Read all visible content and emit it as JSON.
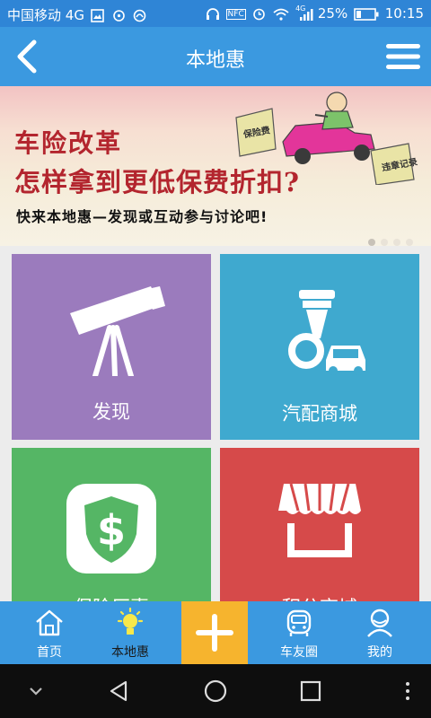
{
  "status_bar": {
    "carrier": "中国移动",
    "network": "4G",
    "signal_label": "4G",
    "battery": "25%",
    "time": "10:15",
    "nfc": "NFC"
  },
  "header": {
    "title": "本地惠"
  },
  "banner": {
    "headline_1": "车险改革",
    "headline_2": "怎样拿到更低保费折扣?",
    "tagline": "快来本地惠—发现或互动参与讨论吧!",
    "sign_left": "保险费",
    "sign_right": "违章记录",
    "slide_count": 4,
    "active_slide": 1
  },
  "tiles": [
    {
      "label": "发现",
      "icon": "telescope-icon",
      "color": "#9b7bbd"
    },
    {
      "label": "汽配商城",
      "icon": "engine-car-icon",
      "color": "#3fa9cf"
    },
    {
      "label": "保险厂惠",
      "icon": "dollar-shield-icon",
      "color": "#55b665"
    },
    {
      "label": "积分商城",
      "icon": "shop-awning-icon",
      "color": "#d64a4a"
    }
  ],
  "tab_bar": {
    "tabs": [
      {
        "label": "首页",
        "icon": "home-icon"
      },
      {
        "label": "本地惠",
        "icon": "lightbulb-icon"
      },
      {
        "label": "车友圈",
        "icon": "car-front-icon"
      },
      {
        "label": "我的",
        "icon": "user-icon"
      }
    ],
    "center_icon": "plus-icon",
    "active": "本地惠"
  },
  "colors": {
    "status_bar": "#2f85d6",
    "app_bar": "#3b99e0",
    "plus_button": "#f6b42e",
    "active_tab_icon": "#f7e84a"
  }
}
